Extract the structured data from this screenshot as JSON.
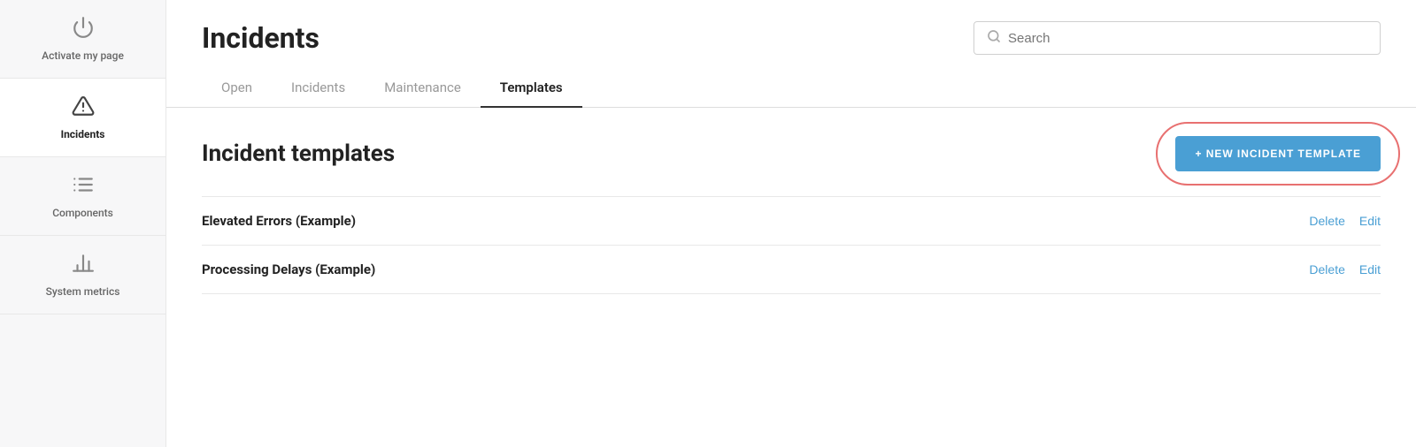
{
  "sidebar": {
    "items": [
      {
        "id": "activate",
        "label": "Activate my page",
        "icon": "power"
      },
      {
        "id": "incidents",
        "label": "Incidents",
        "icon": "warning",
        "active": true
      },
      {
        "id": "components",
        "label": "Components",
        "icon": "list"
      },
      {
        "id": "metrics",
        "label": "System metrics",
        "icon": "chart"
      }
    ]
  },
  "header": {
    "title": "Incidents",
    "search": {
      "placeholder": "Search"
    }
  },
  "tabs": [
    {
      "id": "open",
      "label": "Open"
    },
    {
      "id": "incidents",
      "label": "Incidents"
    },
    {
      "id": "maintenance",
      "label": "Maintenance"
    },
    {
      "id": "templates",
      "label": "Templates",
      "active": true
    }
  ],
  "content": {
    "section_title": "Incident templates",
    "new_button_label": "+ NEW INCIDENT TEMPLATE",
    "templates": [
      {
        "id": 1,
        "name": "Elevated Errors (Example)",
        "delete_label": "Delete",
        "edit_label": "Edit"
      },
      {
        "id": 2,
        "name": "Processing Delays (Example)",
        "delete_label": "Delete",
        "edit_label": "Edit"
      }
    ]
  }
}
